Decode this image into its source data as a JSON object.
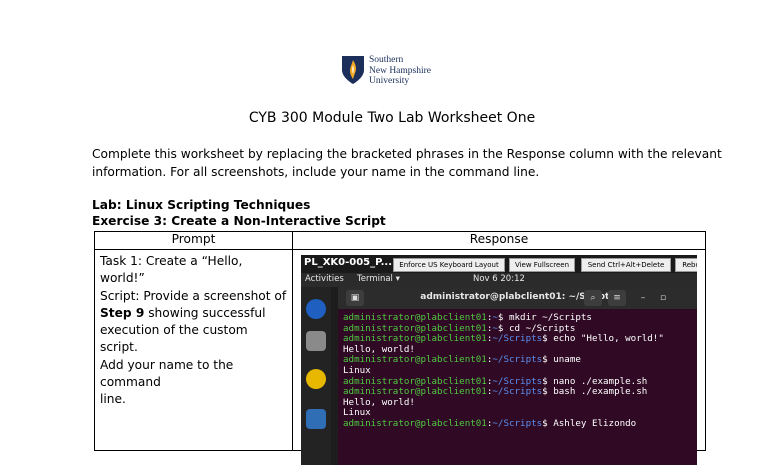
{
  "logo": {
    "lines": [
      "Southern",
      "New Hampshire",
      "University"
    ]
  },
  "title": "CYB 300 Module Two Lab Worksheet One",
  "intro": "Complete this worksheet by replacing the bracketed phrases in the Response column with the relevant information. For all screenshots, include your name in the command line.",
  "lab_heading": "Lab: Linux Scripting Techniques",
  "exercise_heading": "Exercise 3: Create a Non-Interactive Script",
  "table": {
    "headers": [
      "Prompt",
      "Response"
    ],
    "prompt": {
      "line1": "Task 1: Create a “Hello, world!”",
      "line2": "Script: Provide a screenshot of",
      "step_bold": "Step 9",
      "line3_rest": " showing successful",
      "line4": "execution of the custom script.",
      "line5": "Add your name to the command",
      "line6": "line."
    }
  },
  "screenshot": {
    "vm_name": "PL_XK0-005_P...",
    "buttons": [
      "Enforce US Keyboard Layout",
      "View Fullscreen",
      "Send Ctrl+Alt+Delete",
      "Rebo"
    ],
    "activities": "Activities",
    "terminal_menu": "Terminal ▾",
    "clock": "Nov 6  20:12",
    "terminal_title": "administrator@plabclient01: ~/Scripts",
    "prompt_user": "administrator@plabclient01",
    "lines": [
      {
        "path": "~",
        "cmd": "$ mkdir ~/Scripts"
      },
      {
        "path": "~",
        "cmd": "$ cd ~/Scripts"
      },
      {
        "path": "~/Scripts",
        "cmd": "$ echo \"Hello, world!\""
      },
      {
        "output": "Hello, world!"
      },
      {
        "path": "~/Scripts",
        "cmd": "$ uname"
      },
      {
        "output": "Linux"
      },
      {
        "path": "~/Scripts",
        "cmd": "$ nano ./example.sh"
      },
      {
        "path": "~/Scripts",
        "cmd": "$ bash ./example.sh"
      },
      {
        "output": "Hello, world!"
      },
      {
        "output": "Linux"
      },
      {
        "path": "~/Scripts",
        "cmd": "$ Ashley Elizondo"
      }
    ]
  },
  "colors": {
    "terminal_bg": "#300a24",
    "prompt_green": "#4ec940",
    "path_blue": "#5b8ff0",
    "logo_navy": "#1b2f5a",
    "logo_gold": "#f0a824"
  }
}
